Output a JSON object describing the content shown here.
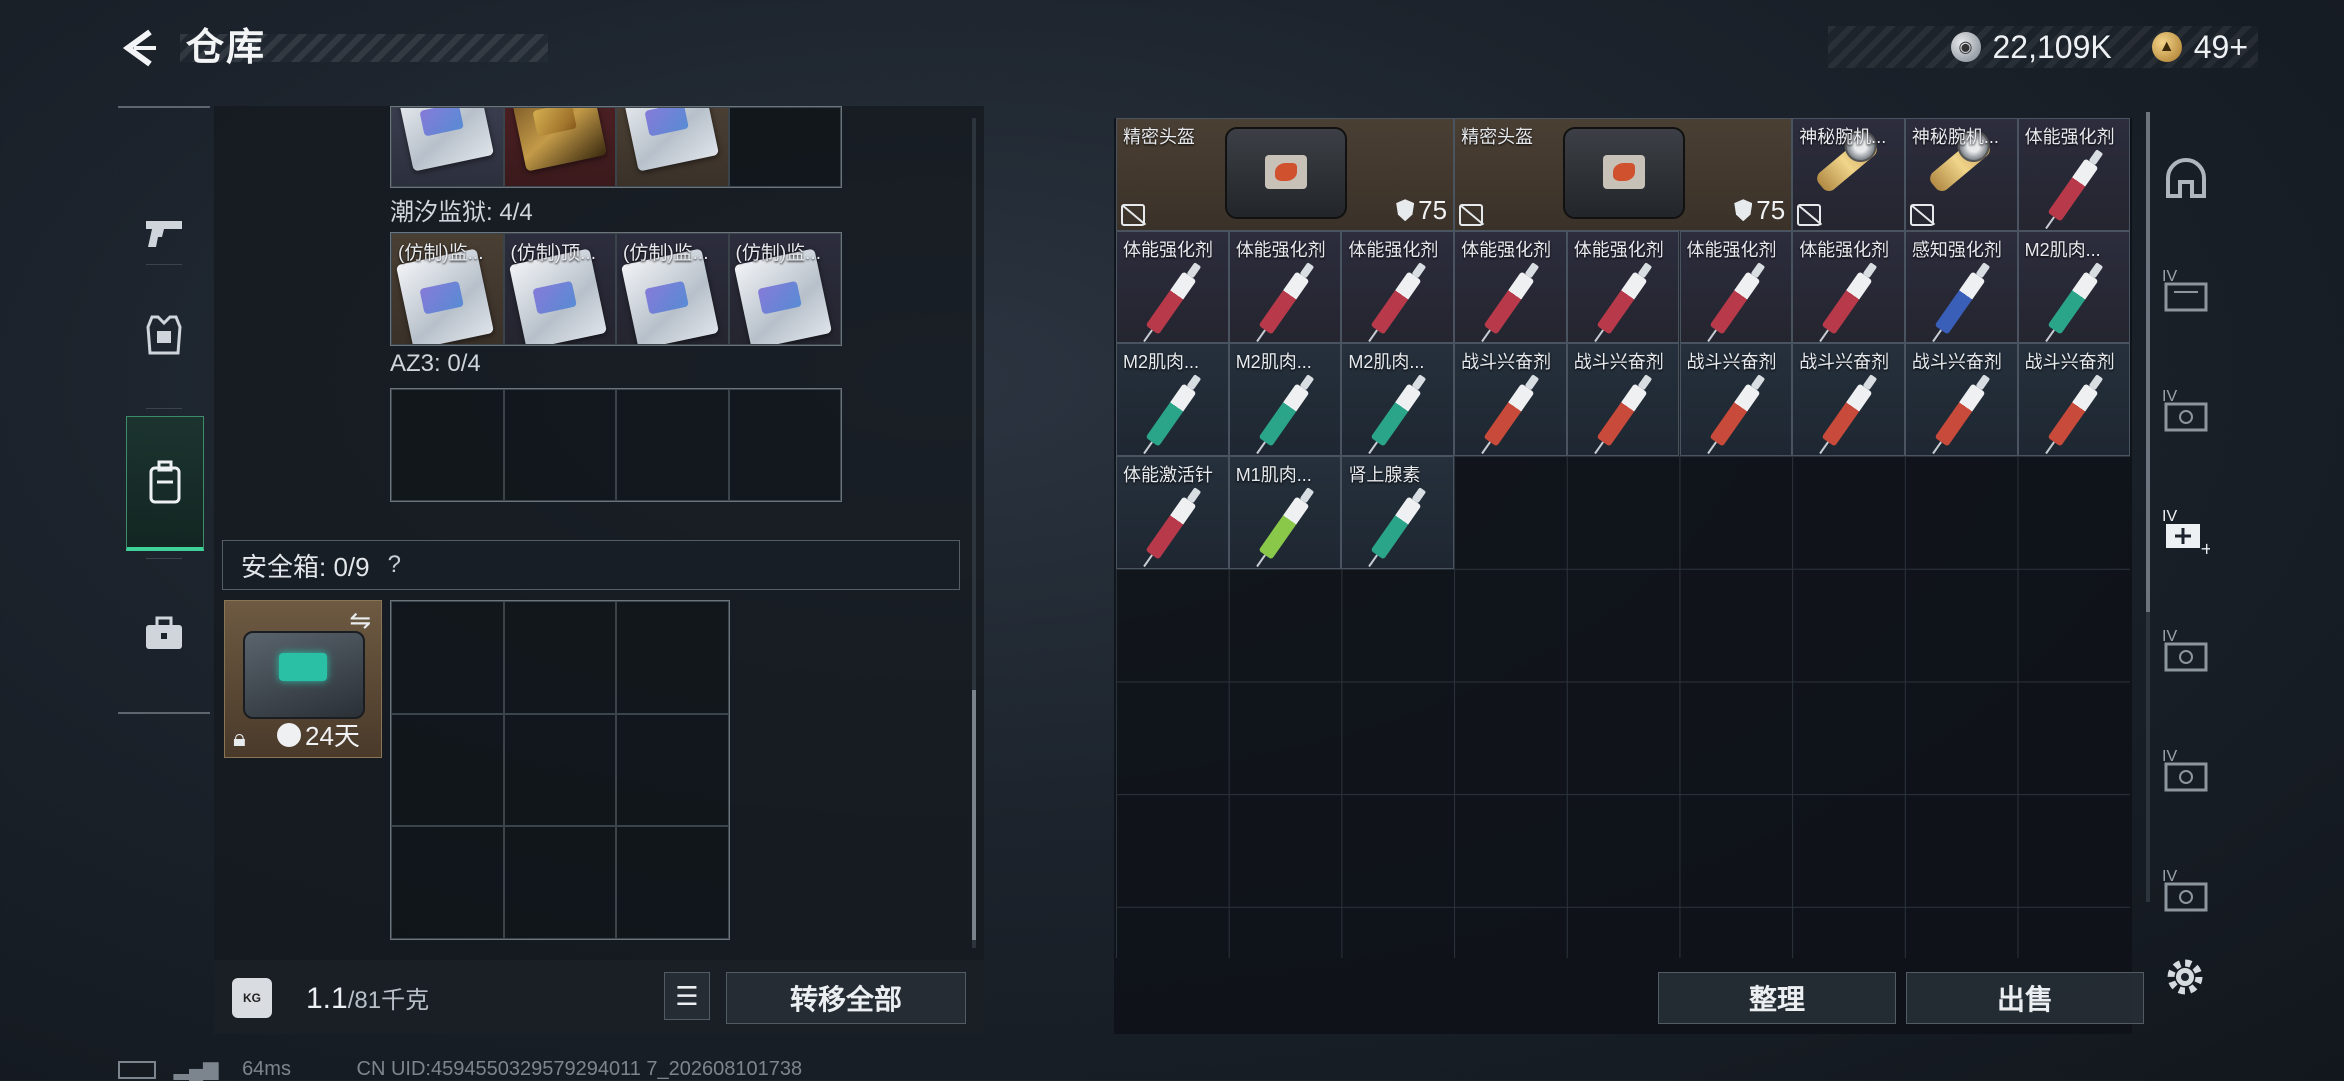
{
  "header": {
    "title": "仓库",
    "currencies": [
      {
        "icon": "silver-coin-icon",
        "value": "22,109K"
      },
      {
        "icon": "gold-coin-icon",
        "value": "49+"
      }
    ]
  },
  "left_tabs": [
    {
      "name": "weapon-tab",
      "icon": "pistol-icon",
      "active": false
    },
    {
      "name": "armor-tab",
      "icon": "armor-vest-icon",
      "active": false
    },
    {
      "name": "backpack-tab",
      "icon": "backpack-icon",
      "active": true
    },
    {
      "name": "briefcase-tab",
      "icon": "briefcase-icon",
      "active": false
    }
  ],
  "key_sections": [
    {
      "label": "潮汐监狱: 4/4",
      "items": [
        "(仿制)监...",
        "(仿制)顶...",
        "(仿制)监...",
        "(仿制)监..."
      ]
    },
    {
      "label": "AZ3: 0/4",
      "items": []
    }
  ],
  "safe_box": {
    "label": "安全箱: 0/9",
    "help": "?",
    "time_left": "24天"
  },
  "left_bottom": {
    "weight_current": "1.1",
    "weight_max": "/81千克",
    "transfer_all": "转移全部"
  },
  "stash_items": [
    {
      "name": "精密头盔",
      "durability": "75",
      "type": "bag"
    },
    {
      "name": "精密头盔",
      "durability": "75",
      "type": "bag"
    },
    {
      "name": "神秘腕机...",
      "type": "watch"
    },
    {
      "name": "神秘腕机...",
      "type": "watch"
    },
    {
      "name": "体能强化剂",
      "type": "syringe",
      "color": "#b83a4a"
    },
    {
      "name": "体能强化剂",
      "type": "syringe",
      "color": "#b83a4a"
    },
    {
      "name": "体能强化剂",
      "type": "syringe",
      "color": "#b83a4a"
    },
    {
      "name": "体能强化剂",
      "type": "syringe",
      "color": "#b83a4a"
    },
    {
      "name": "体能强化剂",
      "type": "syringe",
      "color": "#b83a4a"
    },
    {
      "name": "体能强化剂",
      "type": "syringe",
      "color": "#b83a4a"
    },
    {
      "name": "体能强化剂",
      "type": "syringe",
      "color": "#b83a4a"
    },
    {
      "name": "体能强化剂",
      "type": "syringe",
      "color": "#b83a4a"
    },
    {
      "name": "感知强化剂",
      "type": "syringe",
      "color": "#3a5fb8"
    },
    {
      "name": "M2肌肉...",
      "type": "syringe",
      "color": "#2aa58a"
    },
    {
      "name": "M2肌肉...",
      "type": "syringe",
      "color": "#2aa58a"
    },
    {
      "name": "M2肌肉...",
      "type": "syringe",
      "color": "#2aa58a"
    },
    {
      "name": "M2肌肉...",
      "type": "syringe",
      "color": "#2aa58a"
    },
    {
      "name": "战斗兴奋剂",
      "type": "syringe",
      "color": "#c84a3a"
    },
    {
      "name": "战斗兴奋剂",
      "type": "syringe",
      "color": "#c84a3a"
    },
    {
      "name": "战斗兴奋剂",
      "type": "syringe",
      "color": "#c84a3a"
    },
    {
      "name": "战斗兴奋剂",
      "type": "syringe",
      "color": "#c84a3a"
    },
    {
      "name": "战斗兴奋剂",
      "type": "syringe",
      "color": "#c84a3a"
    },
    {
      "name": "战斗兴奋剂",
      "type": "syringe",
      "color": "#c84a3a"
    },
    {
      "name": "体能激活针",
      "type": "syringe",
      "color": "#b83a4a"
    },
    {
      "name": "M1肌肉...",
      "type": "syringe",
      "color": "#8ac84a"
    },
    {
      "name": "肾上腺素",
      "type": "syringe",
      "color": "#2aa58a"
    }
  ],
  "right_bottom": {
    "sort": "整理",
    "sell": "出售"
  },
  "right_sidebar": [
    {
      "name": "helmet-slot",
      "icon": "helmet-icon"
    },
    {
      "name": "container-iv-1",
      "icon": "storage-box-icon",
      "label": "IV"
    },
    {
      "name": "container-iv-2",
      "icon": "storage-box-icon",
      "label": "IV"
    },
    {
      "name": "container-iv-add",
      "icon": "add-storage-icon",
      "label": "IV"
    },
    {
      "name": "container-iv-3",
      "icon": "storage-box-icon",
      "label": "IV"
    },
    {
      "name": "container-iv-4",
      "icon": "storage-box-icon",
      "label": "IV"
    },
    {
      "name": "container-iv-5",
      "icon": "storage-box-icon",
      "label": "IV"
    }
  ],
  "footer": {
    "ping": "64ms",
    "uid": "CN UID:4594550329579294011 7_202608101738"
  }
}
